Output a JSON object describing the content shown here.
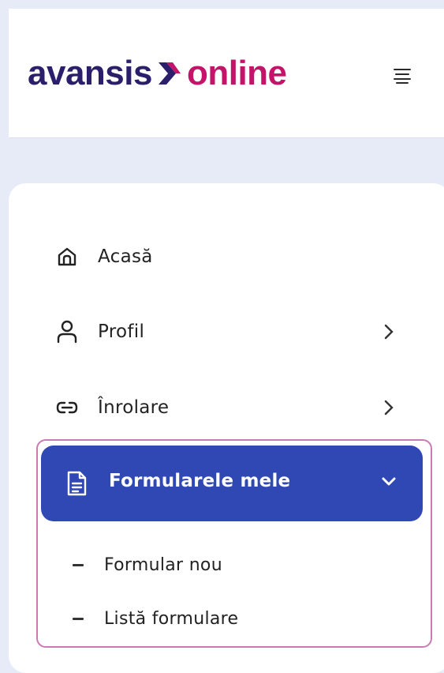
{
  "header": {
    "logo_word1": "avansis",
    "logo_word2": "online",
    "logo_colors": {
      "primary": "#2b1f6b",
      "accent": "#c4146a"
    }
  },
  "menu": {
    "items": [
      {
        "label": "Acasă",
        "icon": "home-icon",
        "has_chevron": false
      },
      {
        "label": "Profil",
        "icon": "user-icon",
        "has_chevron": true
      },
      {
        "label": "Înrolare",
        "icon": "link-icon",
        "has_chevron": true
      }
    ],
    "active": {
      "label": "Formularele mele",
      "icon": "document-icon",
      "expanded": true,
      "color": "#3048b4"
    },
    "subitems": [
      {
        "label": "Formular nou"
      },
      {
        "label": "Listă formulare"
      }
    ]
  },
  "highlight_color": "#c97bb4"
}
